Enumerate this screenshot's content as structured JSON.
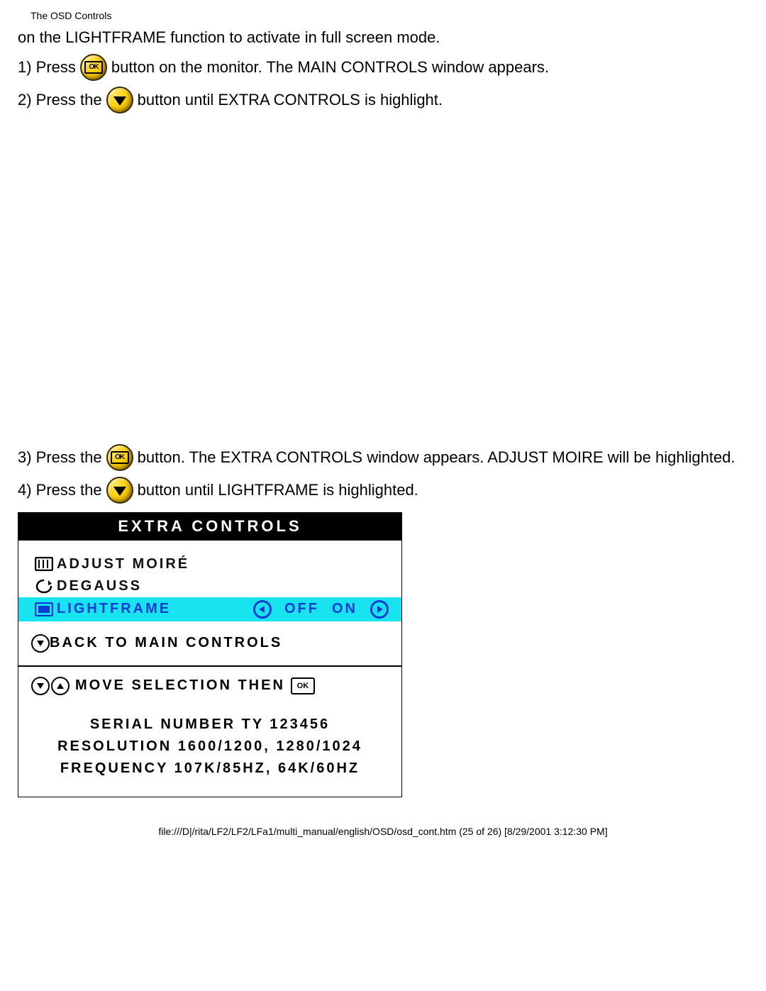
{
  "header": "The OSD Controls",
  "intro": "on the LIGHTFRAME function to activate in full screen mode.",
  "steps": {
    "s1a": "1) Press",
    "s1b": "button on the monitor. The MAIN CONTROLS window appears.",
    "s2a": "2) Press the",
    "s2b": "button until EXTRA CONTROLS is highlight.",
    "s3a": "3) Press the",
    "s3b": "button. The EXTRA CONTROLS window appears. ADJUST MOIRE will be highlighted.",
    "s4a": "4) Press the",
    "s4b": "button until LIGHTFRAME is highlighted."
  },
  "osd": {
    "title": "EXTRA CONTROLS",
    "items": [
      {
        "label": "ADJUST MOIRÉ"
      },
      {
        "label": "DEGAUSS"
      },
      {
        "label": "LIGHTFRAME",
        "off": "OFF",
        "on": "ON",
        "selected": true
      }
    ],
    "back": "BACK TO MAIN CONTROLS",
    "hint": "MOVE SELECTION THEN",
    "serial": "SERIAL NUMBER TY 123456",
    "resolution": "RESOLUTION 1600/1200, 1280/1024",
    "frequency": "FREQUENCY 107K/85HZ, 64K/60HZ"
  },
  "footer": "file:///D|/rita/LF2/LF2/LFa1/multi_manual/english/OSD/osd_cont.htm (25 of 26) [8/29/2001 3:12:30 PM]"
}
